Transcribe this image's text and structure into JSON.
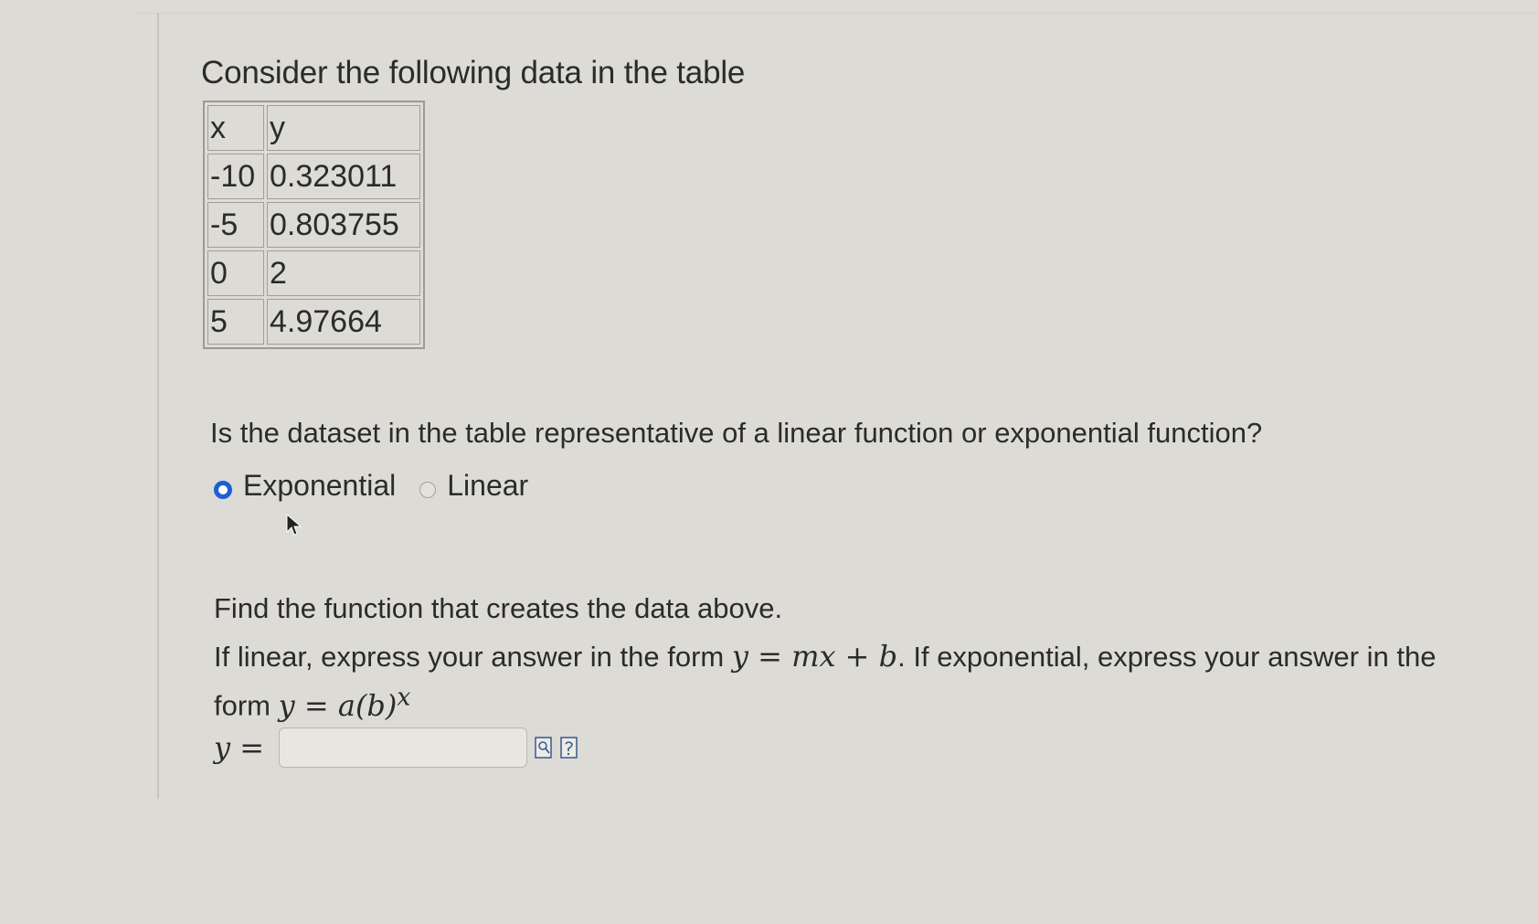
{
  "question": {
    "intro": "Consider the following data in the table",
    "table": {
      "headers": [
        "x",
        "y"
      ],
      "rows": [
        [
          "-10",
          "0.323011"
        ],
        [
          "-5",
          "0.803755"
        ],
        [
          "0",
          "2"
        ],
        [
          "5",
          "4.97664"
        ]
      ]
    },
    "prompt": "Is the dataset in the table representative of a linear function or exponential function?",
    "options": [
      {
        "label": "Exponential",
        "selected": true
      },
      {
        "label": "Linear",
        "selected": false
      }
    ],
    "find_text": "Find the function that creates the data above.",
    "instructions": {
      "part1": "If linear, express your answer in the form ",
      "linear_form": "y = mx + b",
      "part2": ". If exponential, express your answer in the form ",
      "exp_form": "y = a(b)",
      "exp_superscript": "x"
    },
    "answer": {
      "label": "y =",
      "value": ""
    }
  },
  "colors": {
    "background": "#dcdbd6",
    "radio_selected": "#1d5fd6"
  },
  "icons": [
    "preview-icon",
    "help-icon"
  ]
}
